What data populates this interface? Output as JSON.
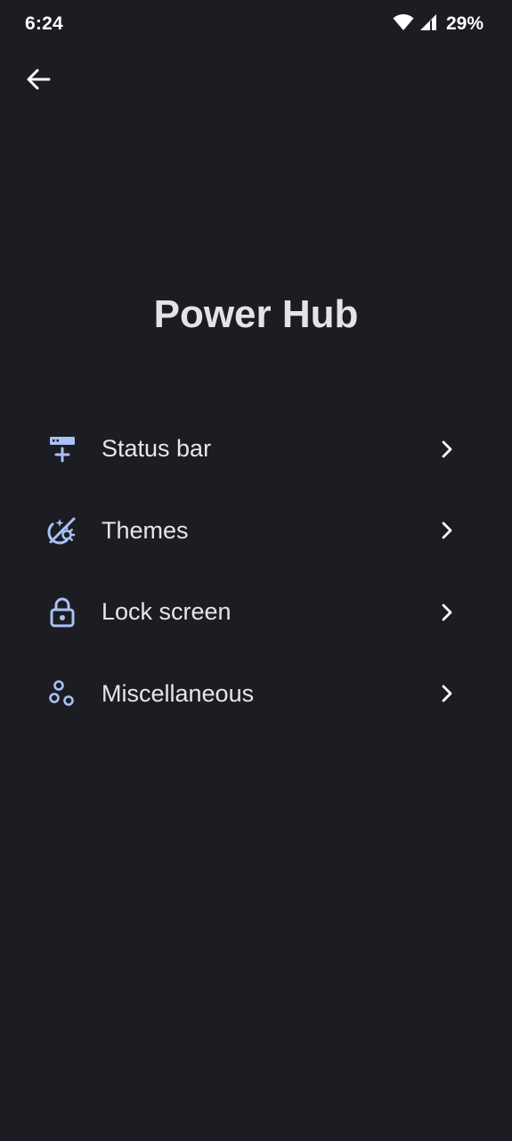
{
  "status_bar": {
    "time": "6:24",
    "battery": "29%",
    "icons": [
      "wifi-icon",
      "cellular-signal-icon"
    ]
  },
  "header": {
    "back_icon": "arrow-left-icon"
  },
  "page": {
    "title": "Power Hub"
  },
  "menu": {
    "items": [
      {
        "label": "Status bar",
        "icon": "status-bar-add-icon"
      },
      {
        "label": "Themes",
        "icon": "themes-icon"
      },
      {
        "label": "Lock screen",
        "icon": "lock-icon"
      },
      {
        "label": "Miscellaneous",
        "icon": "misc-circles-icon"
      }
    ]
  },
  "colors": {
    "background": "#1c1d22",
    "icon_accent": "#a9c1f5",
    "text": "#e6e6ea"
  }
}
